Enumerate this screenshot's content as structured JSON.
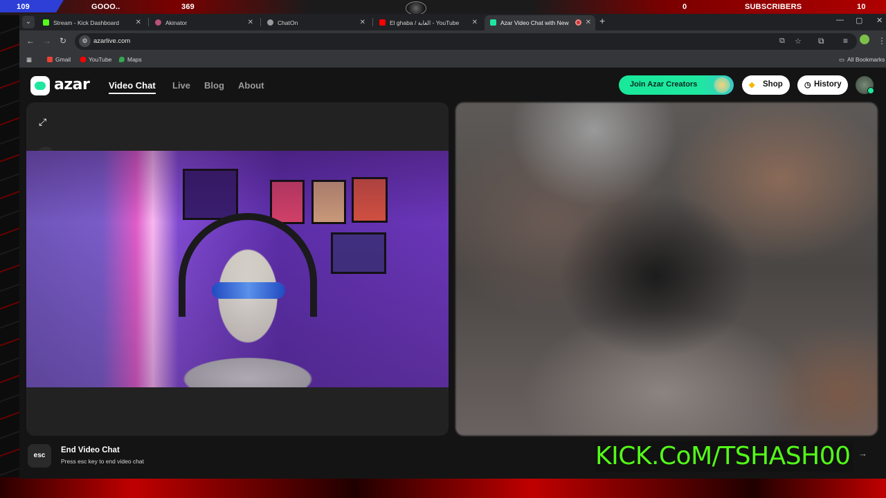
{
  "overlay": {
    "left_count": "109",
    "title": "GOOO..",
    "count2": "369",
    "count3": "0",
    "subs_label": "SUBSCRIBERS",
    "subs_count": "10"
  },
  "tabs": [
    {
      "label": "Stream - Kick Dashboard",
      "favicon_color": "#53fc18",
      "close": "✕"
    },
    {
      "label": "Akinator",
      "favicon_color": "#b8507a",
      "close": "✕"
    },
    {
      "label": "ChatOn",
      "favicon_color": "#9a9a9a",
      "close": "✕"
    },
    {
      "label": "El ghaba / الغابة - YouTube",
      "favicon_color": "#ff0000",
      "close": "✕"
    },
    {
      "label": "Azar Video Chat with New",
      "favicon_color": "#1ee8a0",
      "close": "✕",
      "active": true
    }
  ],
  "toolbar": {
    "url": "azarlive.com"
  },
  "bookmarks": [
    {
      "label": "Gmail",
      "color": "#ea4335"
    },
    {
      "label": "YouTube",
      "color": "#ff0000"
    },
    {
      "label": "Maps",
      "color": "#34a853"
    }
  ],
  "bookmarks_all": "All Bookmarks",
  "site": {
    "logo": "azar",
    "nav": [
      "Video Chat",
      "Live",
      "Blog",
      "About"
    ],
    "join_label": "Join Azar Creators",
    "shop_label": "Shop",
    "history_label": "History",
    "accent": "#1ee8a0"
  },
  "footer": {
    "esc_key": "esc",
    "end_title": "End Video Chat",
    "end_subtitle": "Press esc key to end video chat",
    "stream_url": "KICK.CoM/TSHASH00"
  }
}
